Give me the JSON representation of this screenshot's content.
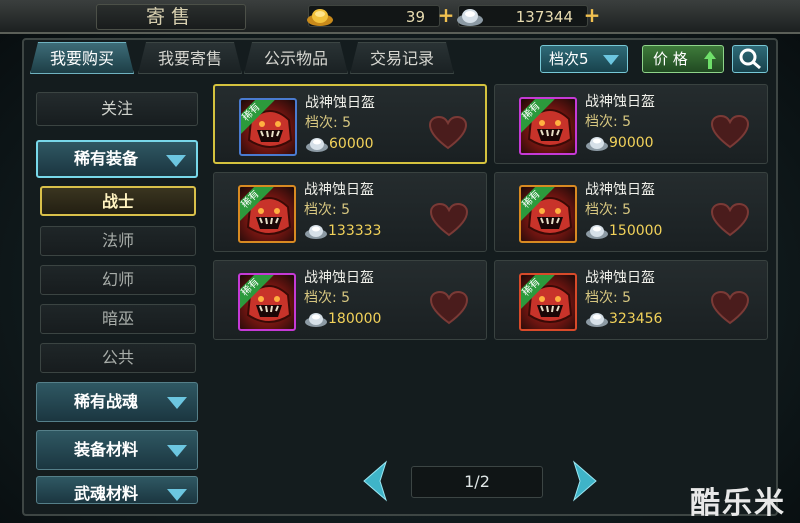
{
  "header": {
    "title": "寄售",
    "gold": "39",
    "silver": "137344"
  },
  "tabs": [
    {
      "label": "我要购买"
    },
    {
      "label": "我要寄售"
    },
    {
      "label": "公示物品"
    },
    {
      "label": "交易记录"
    }
  ],
  "toolbar": {
    "tier_filter": "档次5",
    "price_sort": "价 格"
  },
  "sidebar": {
    "follow": "关注",
    "rare_equipment": "稀有装备",
    "subs": [
      "战士",
      "法师",
      "幻师",
      "暗巫",
      "公共"
    ],
    "rare_soul": "稀有战魂",
    "materials": "装备材料",
    "weapon_soul": "武魂材料"
  },
  "items": [
    {
      "name": "战神蚀日盔",
      "tier": "档次: 5",
      "price": "60000",
      "badge": "稀有",
      "frame_color": "#4a7bd0"
    },
    {
      "name": "战神蚀日盔",
      "tier": "档次: 5",
      "price": "90000",
      "badge": "稀有",
      "frame_color": "#c53ad6"
    },
    {
      "name": "战神蚀日盔",
      "tier": "档次: 5",
      "price": "133333",
      "badge": "稀有",
      "frame_color": "#d88a22"
    },
    {
      "name": "战神蚀日盔",
      "tier": "档次: 5",
      "price": "150000",
      "badge": "稀有",
      "frame_color": "#d88a22"
    },
    {
      "name": "战神蚀日盔",
      "tier": "档次: 5",
      "price": "180000",
      "badge": "稀有",
      "frame_color": "#c53ad6"
    },
    {
      "name": "战神蚀日盔",
      "tier": "档次: 5",
      "price": "323456",
      "badge": "稀有",
      "frame_color": "#d84a2a"
    }
  ],
  "pager": {
    "page": "1/2"
  },
  "watermark": "酷乐米",
  "icons": {
    "gold": "gold-ingot-icon",
    "silver": "silver-ingot-icon",
    "search": "search-icon",
    "favorite": "heart-icon",
    "prev": "arrow-left-icon",
    "next": "arrow-right-icon"
  }
}
